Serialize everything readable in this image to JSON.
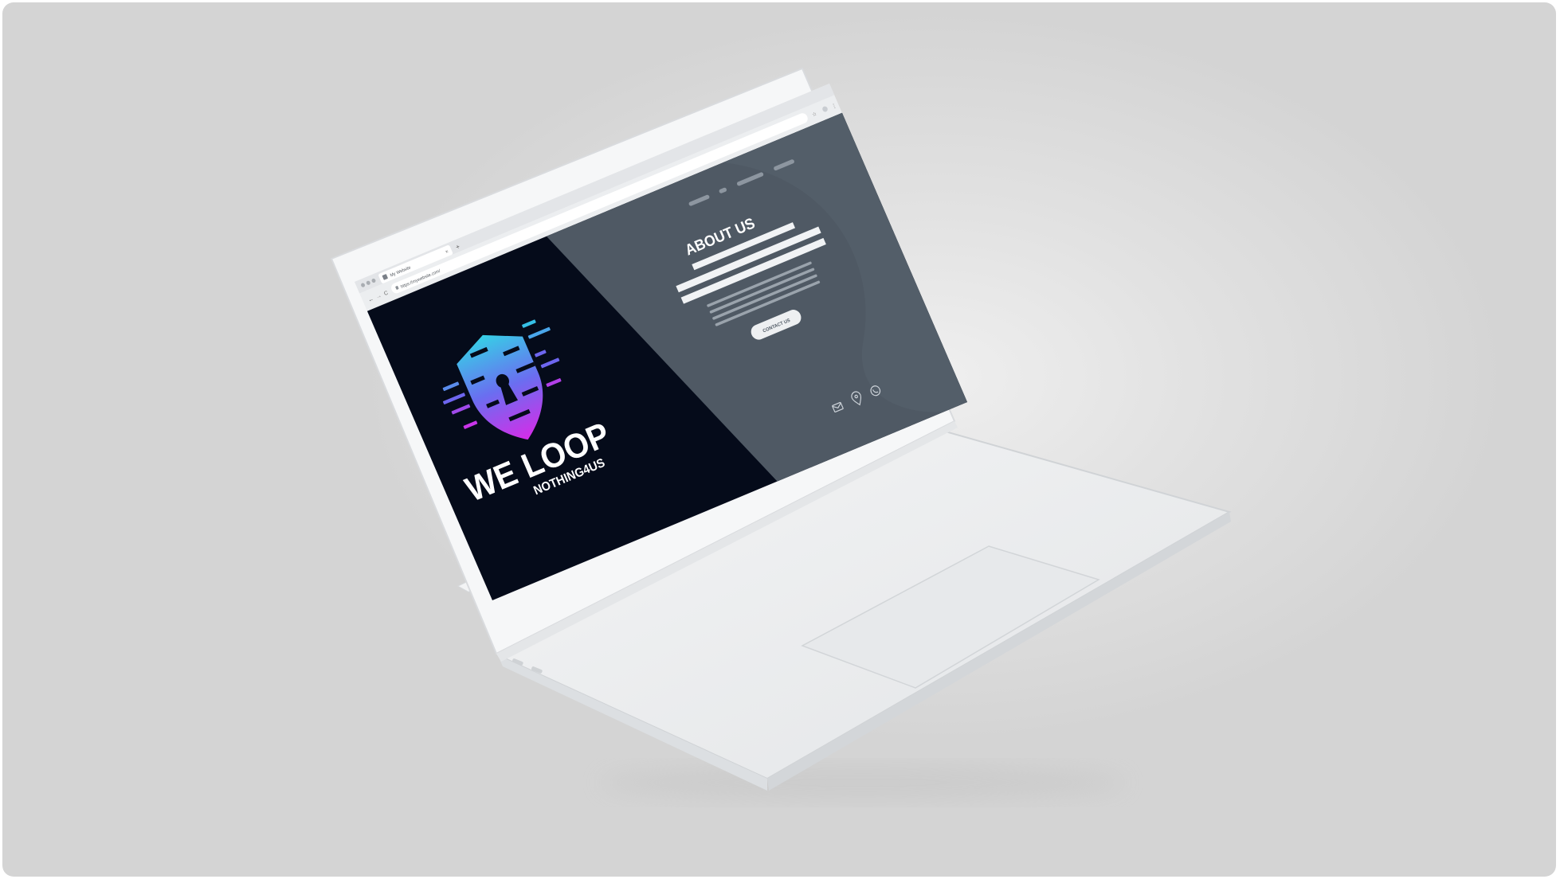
{
  "browser": {
    "tab_title": "My Website",
    "tab_close": "×",
    "new_tab": "+",
    "url": "https://mywebsite.com/",
    "nav_back": "←",
    "nav_forward": "→",
    "nav_reload": "C",
    "star": "☆",
    "menu": "⋮"
  },
  "brand": {
    "name": "WE LOOP",
    "tagline": "NOTHING4US",
    "logo_icon": "shield-keyhole-icon",
    "gradient": [
      "#36d0e6",
      "#6a6ef0",
      "#d52ce8"
    ]
  },
  "about": {
    "heading": "ABOUT US",
    "button_label": "CONTACT US",
    "contact_icons": [
      "mail-icon",
      "location-pin-icon",
      "phone-icon"
    ]
  },
  "colors": {
    "left_panel": "#050b1a",
    "right_panel": "#4f5964",
    "laptop_body": "#eef0f2"
  }
}
